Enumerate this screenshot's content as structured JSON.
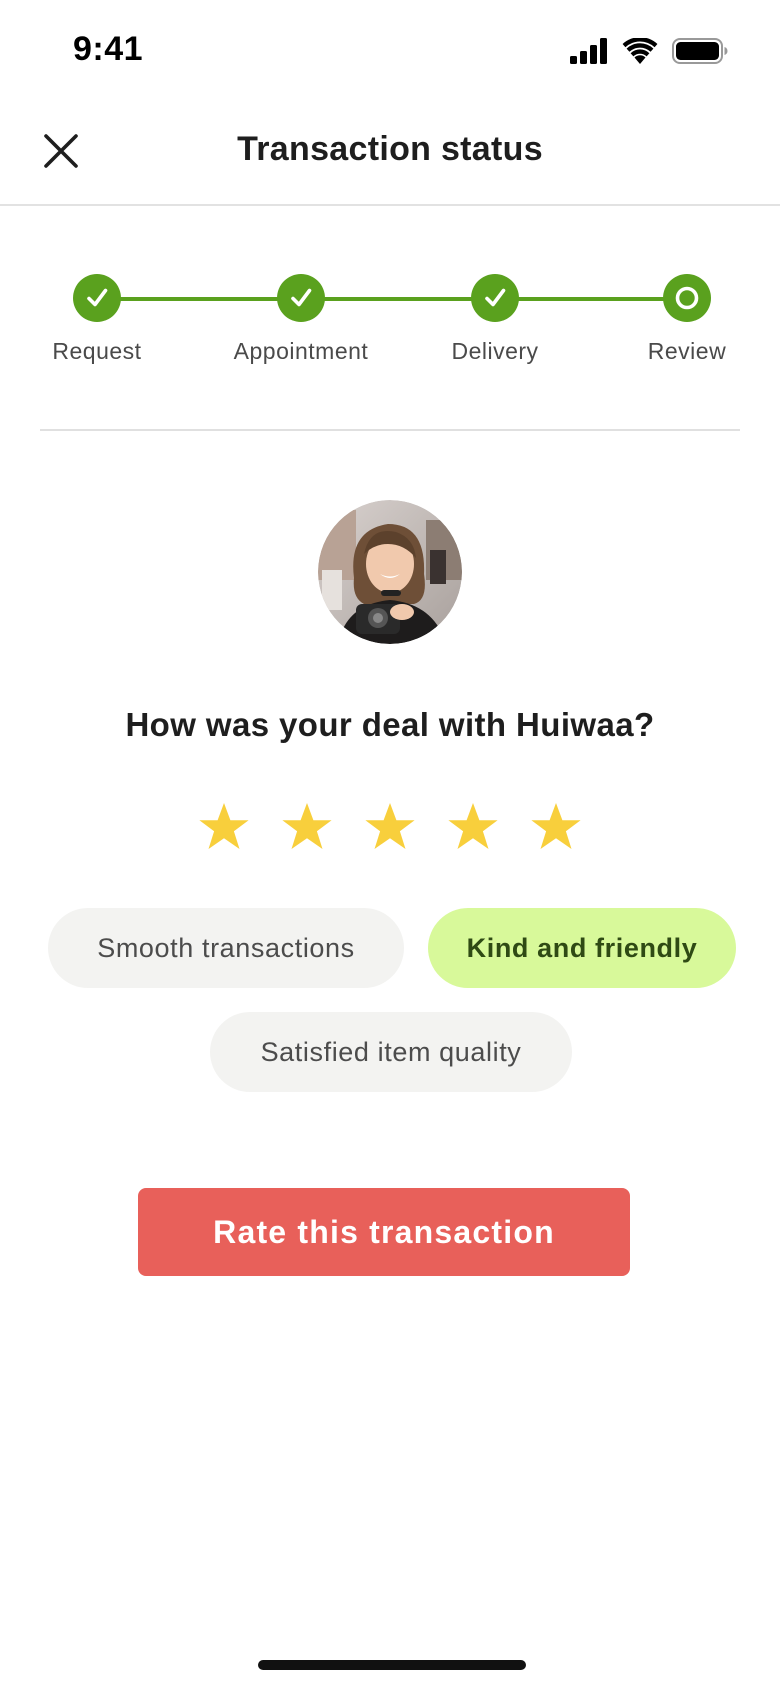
{
  "status_bar": {
    "time": "9:41"
  },
  "header": {
    "title": "Transaction status",
    "close_icon": "close-icon"
  },
  "stepper": {
    "active_color": "#5aa11e",
    "steps": [
      {
        "label": "Request",
        "state": "done"
      },
      {
        "label": "Appointment",
        "state": "done"
      },
      {
        "label": "Delivery",
        "state": "done"
      },
      {
        "label": "Review",
        "state": "current"
      }
    ]
  },
  "review": {
    "avatar": "seller-avatar-photo",
    "question": "How was your deal with Huiwaa?",
    "rating": 5,
    "rating_max": 5,
    "star_color": "#f8cf3c",
    "tags": [
      {
        "label": "Smooth transactions",
        "selected": false
      },
      {
        "label": "Kind and friendly",
        "selected": true
      },
      {
        "label": "Satisfied item quality",
        "selected": false
      }
    ]
  },
  "cta": {
    "label": "Rate this transaction",
    "color": "#e8605a"
  }
}
